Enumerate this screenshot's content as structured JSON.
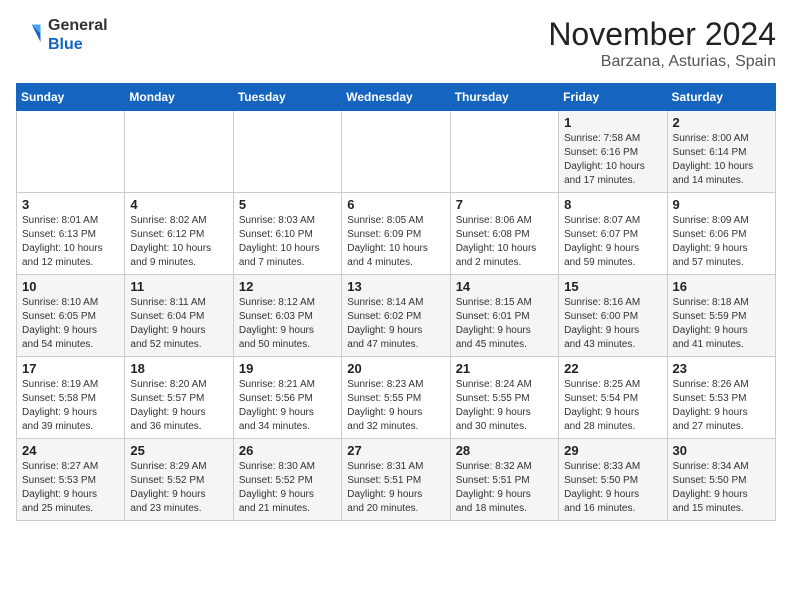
{
  "header": {
    "logo_line1": "General",
    "logo_line2": "Blue",
    "month": "November 2024",
    "location": "Barzana, Asturias, Spain"
  },
  "weekdays": [
    "Sunday",
    "Monday",
    "Tuesday",
    "Wednesday",
    "Thursday",
    "Friday",
    "Saturday"
  ],
  "weeks": [
    [
      {
        "day": "",
        "info": ""
      },
      {
        "day": "",
        "info": ""
      },
      {
        "day": "",
        "info": ""
      },
      {
        "day": "",
        "info": ""
      },
      {
        "day": "",
        "info": ""
      },
      {
        "day": "1",
        "info": "Sunrise: 7:58 AM\nSunset: 6:16 PM\nDaylight: 10 hours\nand 17 minutes."
      },
      {
        "day": "2",
        "info": "Sunrise: 8:00 AM\nSunset: 6:14 PM\nDaylight: 10 hours\nand 14 minutes."
      }
    ],
    [
      {
        "day": "3",
        "info": "Sunrise: 8:01 AM\nSunset: 6:13 PM\nDaylight: 10 hours\nand 12 minutes."
      },
      {
        "day": "4",
        "info": "Sunrise: 8:02 AM\nSunset: 6:12 PM\nDaylight: 10 hours\nand 9 minutes."
      },
      {
        "day": "5",
        "info": "Sunrise: 8:03 AM\nSunset: 6:10 PM\nDaylight: 10 hours\nand 7 minutes."
      },
      {
        "day": "6",
        "info": "Sunrise: 8:05 AM\nSunset: 6:09 PM\nDaylight: 10 hours\nand 4 minutes."
      },
      {
        "day": "7",
        "info": "Sunrise: 8:06 AM\nSunset: 6:08 PM\nDaylight: 10 hours\nand 2 minutes."
      },
      {
        "day": "8",
        "info": "Sunrise: 8:07 AM\nSunset: 6:07 PM\nDaylight: 9 hours\nand 59 minutes."
      },
      {
        "day": "9",
        "info": "Sunrise: 8:09 AM\nSunset: 6:06 PM\nDaylight: 9 hours\nand 57 minutes."
      }
    ],
    [
      {
        "day": "10",
        "info": "Sunrise: 8:10 AM\nSunset: 6:05 PM\nDaylight: 9 hours\nand 54 minutes."
      },
      {
        "day": "11",
        "info": "Sunrise: 8:11 AM\nSunset: 6:04 PM\nDaylight: 9 hours\nand 52 minutes."
      },
      {
        "day": "12",
        "info": "Sunrise: 8:12 AM\nSunset: 6:03 PM\nDaylight: 9 hours\nand 50 minutes."
      },
      {
        "day": "13",
        "info": "Sunrise: 8:14 AM\nSunset: 6:02 PM\nDaylight: 9 hours\nand 47 minutes."
      },
      {
        "day": "14",
        "info": "Sunrise: 8:15 AM\nSunset: 6:01 PM\nDaylight: 9 hours\nand 45 minutes."
      },
      {
        "day": "15",
        "info": "Sunrise: 8:16 AM\nSunset: 6:00 PM\nDaylight: 9 hours\nand 43 minutes."
      },
      {
        "day": "16",
        "info": "Sunrise: 8:18 AM\nSunset: 5:59 PM\nDaylight: 9 hours\nand 41 minutes."
      }
    ],
    [
      {
        "day": "17",
        "info": "Sunrise: 8:19 AM\nSunset: 5:58 PM\nDaylight: 9 hours\nand 39 minutes."
      },
      {
        "day": "18",
        "info": "Sunrise: 8:20 AM\nSunset: 5:57 PM\nDaylight: 9 hours\nand 36 minutes."
      },
      {
        "day": "19",
        "info": "Sunrise: 8:21 AM\nSunset: 5:56 PM\nDaylight: 9 hours\nand 34 minutes."
      },
      {
        "day": "20",
        "info": "Sunrise: 8:23 AM\nSunset: 5:55 PM\nDaylight: 9 hours\nand 32 minutes."
      },
      {
        "day": "21",
        "info": "Sunrise: 8:24 AM\nSunset: 5:55 PM\nDaylight: 9 hours\nand 30 minutes."
      },
      {
        "day": "22",
        "info": "Sunrise: 8:25 AM\nSunset: 5:54 PM\nDaylight: 9 hours\nand 28 minutes."
      },
      {
        "day": "23",
        "info": "Sunrise: 8:26 AM\nSunset: 5:53 PM\nDaylight: 9 hours\nand 27 minutes."
      }
    ],
    [
      {
        "day": "24",
        "info": "Sunrise: 8:27 AM\nSunset: 5:53 PM\nDaylight: 9 hours\nand 25 minutes."
      },
      {
        "day": "25",
        "info": "Sunrise: 8:29 AM\nSunset: 5:52 PM\nDaylight: 9 hours\nand 23 minutes."
      },
      {
        "day": "26",
        "info": "Sunrise: 8:30 AM\nSunset: 5:52 PM\nDaylight: 9 hours\nand 21 minutes."
      },
      {
        "day": "27",
        "info": "Sunrise: 8:31 AM\nSunset: 5:51 PM\nDaylight: 9 hours\nand 20 minutes."
      },
      {
        "day": "28",
        "info": "Sunrise: 8:32 AM\nSunset: 5:51 PM\nDaylight: 9 hours\nand 18 minutes."
      },
      {
        "day": "29",
        "info": "Sunrise: 8:33 AM\nSunset: 5:50 PM\nDaylight: 9 hours\nand 16 minutes."
      },
      {
        "day": "30",
        "info": "Sunrise: 8:34 AM\nSunset: 5:50 PM\nDaylight: 9 hours\nand 15 minutes."
      }
    ]
  ]
}
